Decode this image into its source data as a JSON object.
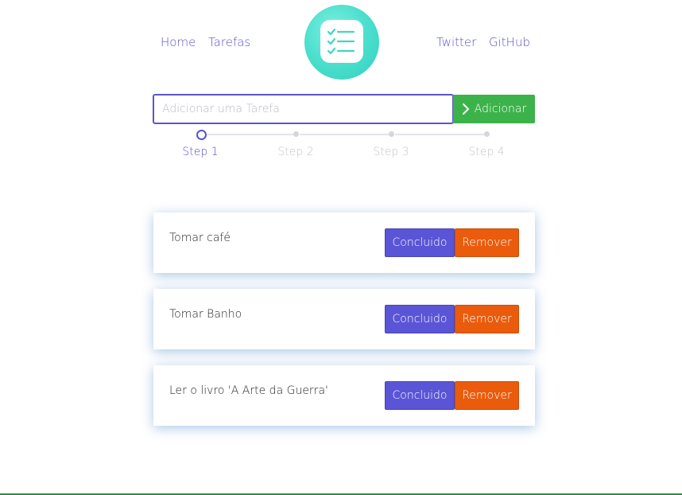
{
  "nav": {
    "home": "Home",
    "tasks": "Tarefas",
    "twitter": "Twitter",
    "github": "GitHub"
  },
  "logo": {
    "icon": "checklist-icon"
  },
  "add_form": {
    "placeholder": "Adicionar uma Tarefa",
    "value": "",
    "button_label": "Adicionar"
  },
  "steps": [
    {
      "label": "Step 1",
      "active": true
    },
    {
      "label": "Step 2",
      "active": false
    },
    {
      "label": "Step 3",
      "active": false
    },
    {
      "label": "Step 4",
      "active": false
    }
  ],
  "tasks": [
    {
      "text": "Tomar café",
      "done_label": "Concluido",
      "remove_label": "Remover"
    },
    {
      "text": "Tomar Banho",
      "done_label": "Concluido",
      "remove_label": "Remover"
    },
    {
      "text": "Ler o livro 'A Arte da Guerra'",
      "done_label": "Concluido",
      "remove_label": "Remover"
    }
  ],
  "colors": {
    "accent": "#5a55c8",
    "add_button": "#3cb34a",
    "done_button": "#5a55d6",
    "remove_button": "#ea5b0c",
    "logo": "#4fe0cf"
  }
}
